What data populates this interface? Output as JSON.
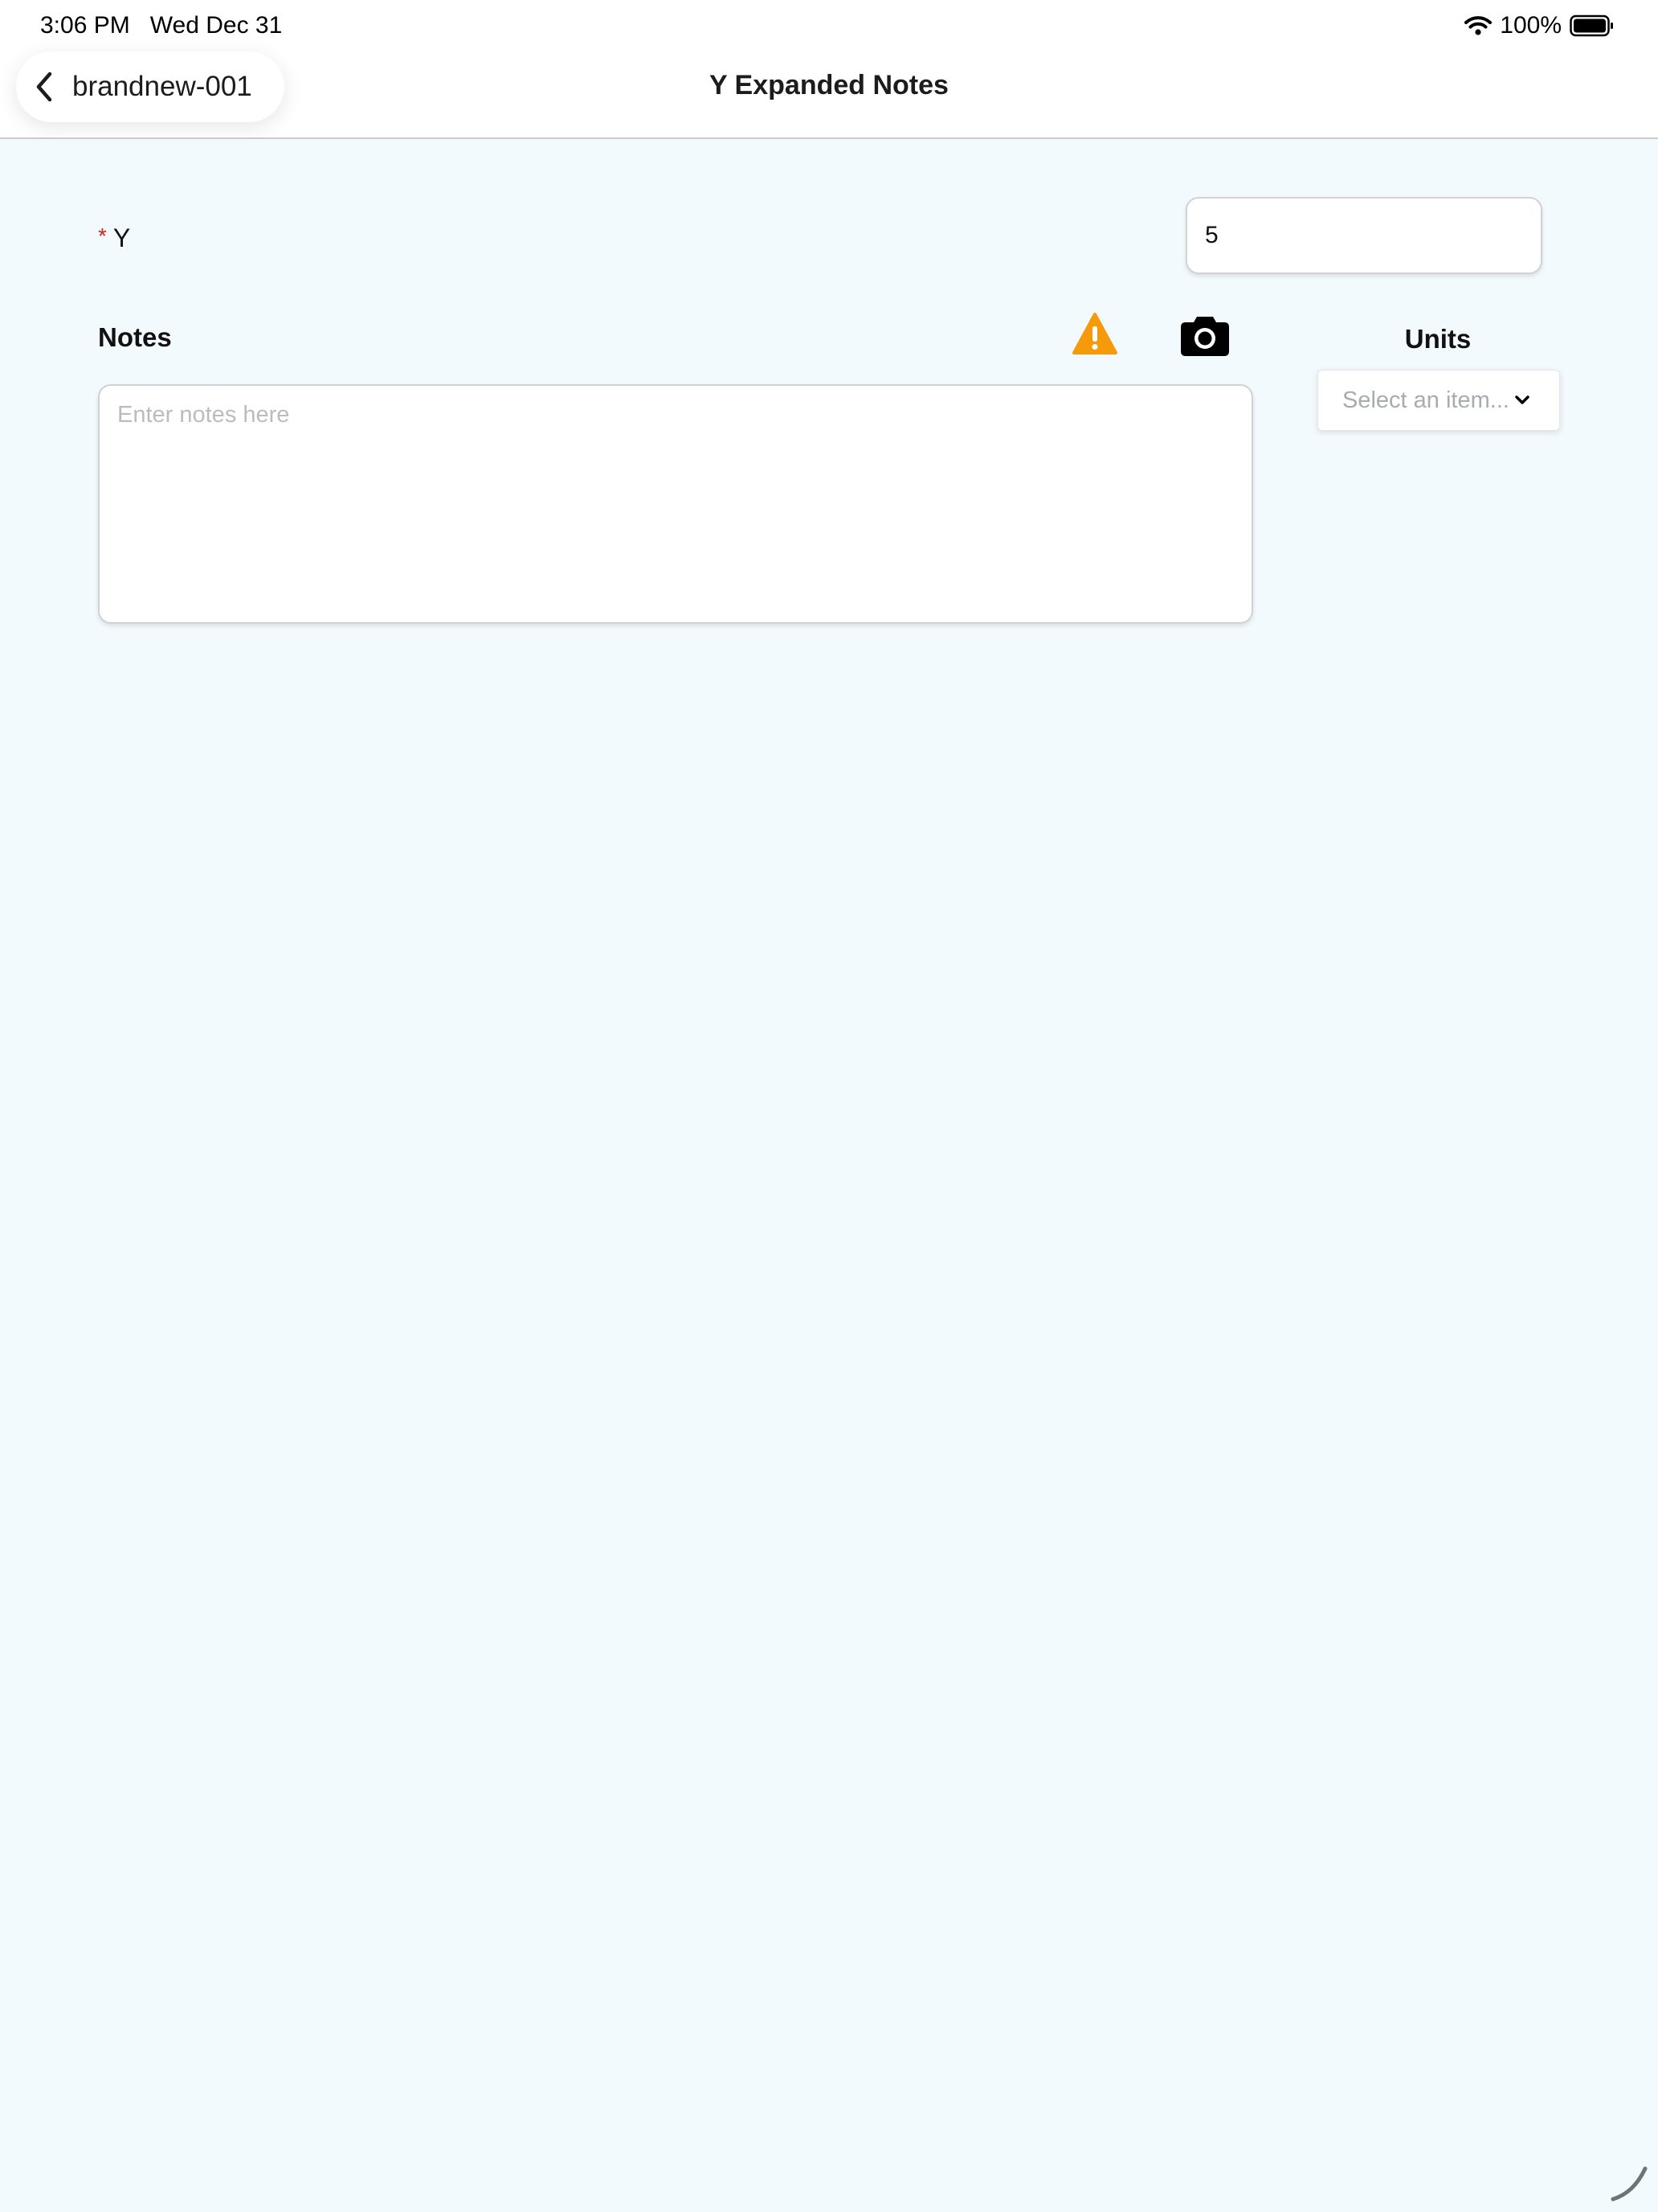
{
  "status_bar": {
    "time": "3:06 PM",
    "date": "Wed Dec 31",
    "battery": "100%",
    "icons": [
      "wifi-icon",
      "battery-icon"
    ]
  },
  "nav": {
    "back_label": "brandnew-001",
    "back_icon": "chevron-left-icon",
    "title": "Y Expanded Notes"
  },
  "field": {
    "required_marker": "*",
    "label": "Y",
    "value": "5"
  },
  "notes": {
    "label": "Notes",
    "placeholder": "Enter notes here",
    "warning_icon": "warning-icon",
    "camera_icon": "camera-icon"
  },
  "units": {
    "label": "Units",
    "placeholder": "Select an item..."
  },
  "colors": {
    "background": "#f3fafd",
    "required": "#e01e1e",
    "warning": "#f59a0b"
  }
}
